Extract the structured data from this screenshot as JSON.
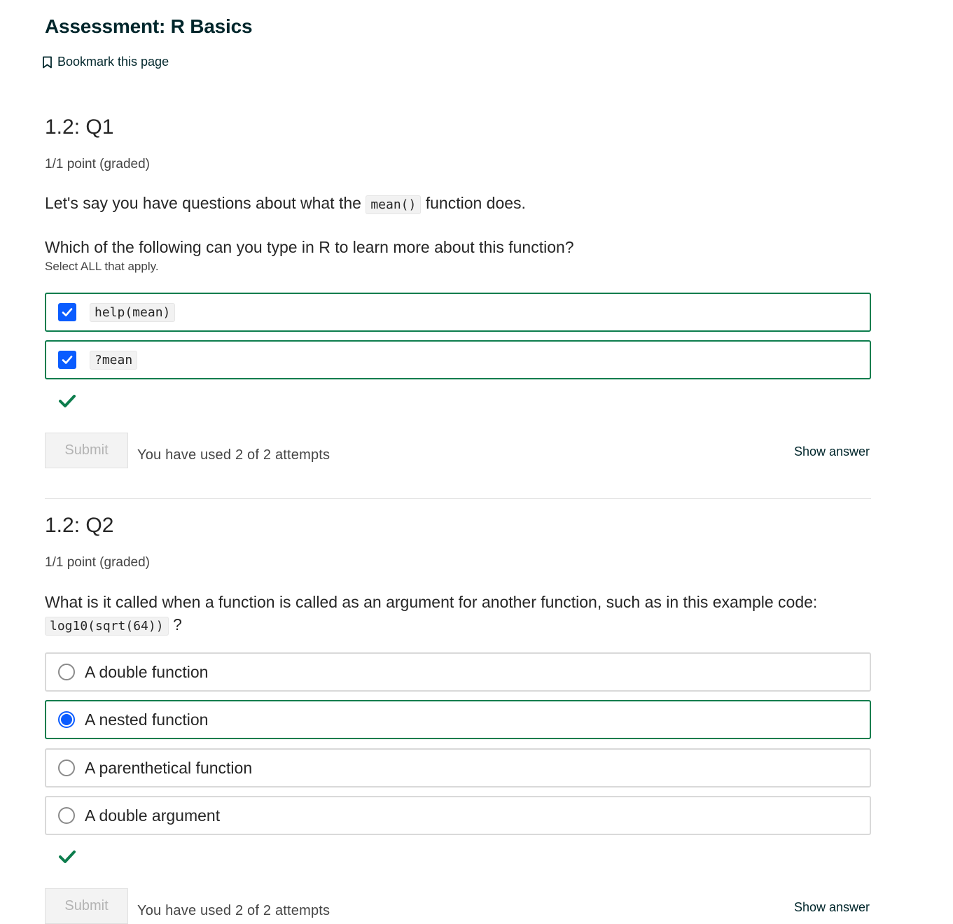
{
  "page": {
    "title": "Assessment: R Basics",
    "bookmark_label": "Bookmark this page"
  },
  "q1": {
    "title": "1.2: Q1",
    "points": "1/1 point (graded)",
    "text_before": "Let's say you have questions about what the",
    "text_code": "mean()",
    "text_after": "function does.",
    "prompt": "Which of the following can you type in R to learn more about this function?",
    "instruction": "Select ALL that apply.",
    "options": [
      {
        "code": "help(mean)",
        "checked": true
      },
      {
        "code": "?mean",
        "checked": true
      }
    ],
    "status_icon": "checkmark-icon",
    "submit_label": "Submit",
    "attempts": "You have used 2 of 2 attempts",
    "show_answer": "Show answer"
  },
  "q2": {
    "title": "1.2: Q2",
    "points": "1/1 point (graded)",
    "text": "What is it called when a function is called as an argument for another function, such as in this example code:",
    "code": "log10(sqrt(64))",
    "text_end": "?",
    "options": [
      {
        "label": "A double function",
        "selected": false
      },
      {
        "label": "A nested function",
        "selected": true
      },
      {
        "label": "A parenthetical function",
        "selected": false
      },
      {
        "label": "A double argument",
        "selected": false
      }
    ],
    "status_icon": "checkmark-icon",
    "submit_label": "Submit",
    "attempts": "You have used 2 of 2 attempts",
    "show_answer": "Show answer"
  },
  "colors": {
    "correct_green": "#0d7d4d",
    "checkbox_blue": "#0a5cff",
    "title_dark": "#00262b"
  }
}
